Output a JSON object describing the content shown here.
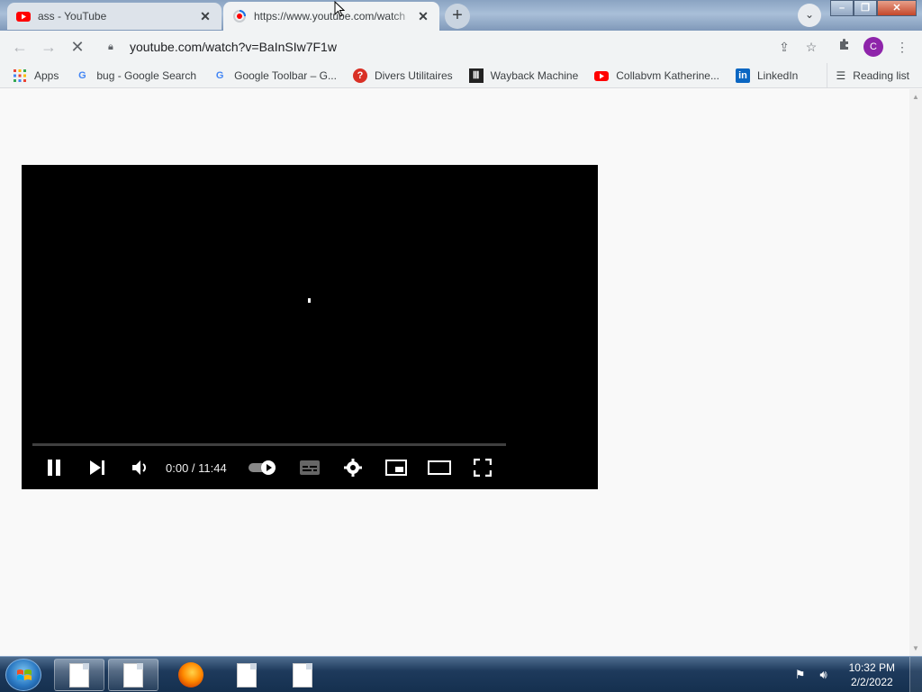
{
  "tabs": [
    {
      "title": "ass - YouTube",
      "favicon": "youtube-icon",
      "active": false
    },
    {
      "title": "https://www.youtube.com/watch",
      "favicon": "loading-icon",
      "active": true
    }
  ],
  "toolbar": {
    "url": "youtube.com/watch?v=BaInSIw7F1w"
  },
  "avatar_letter": "C",
  "bookmarks": [
    {
      "label": "Apps",
      "icon": "apps-grid-icon"
    },
    {
      "label": "bug - Google Search",
      "icon": "google-icon"
    },
    {
      "label": "Google Toolbar – G...",
      "icon": "google-icon"
    },
    {
      "label": "Divers Utilitaires",
      "icon": "question-icon"
    },
    {
      "label": "Wayback Machine",
      "icon": "archive-icon"
    },
    {
      "label": "Collabvm Katherine...",
      "icon": "youtube-icon"
    },
    {
      "label": "LinkedIn",
      "icon": "linkedin-icon"
    }
  ],
  "reading_list": "Reading list",
  "player": {
    "current_time": "0:00",
    "separator": " / ",
    "duration": "11:44",
    "progress": 0
  },
  "taskbar": {
    "time": "10:32 PM",
    "date": "2/2/2022"
  },
  "colors": {
    "youtube_red": "#ff0000",
    "avatar": "#8e24aa",
    "taskbar": "#1e3a5c"
  }
}
